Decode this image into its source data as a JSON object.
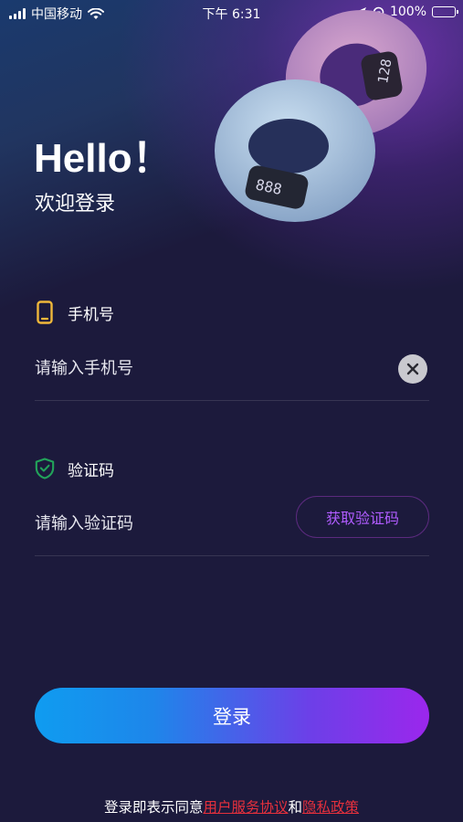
{
  "status_bar": {
    "carrier": "中国移动",
    "time": "下午 6:31",
    "battery": "100%",
    "icons": [
      "signal-icon",
      "wifi-icon",
      "location-icon",
      "rotation-lock-icon",
      "battery-charging-icon"
    ]
  },
  "hero": {
    "title": "Hello！",
    "subtitle": "欢迎登录",
    "display_small": "128",
    "display_large": "888"
  },
  "phone": {
    "label": "手机号",
    "placeholder": "请输入手机号",
    "icon": "phone-icon",
    "icon_color": "#f0b83a"
  },
  "code": {
    "label": "验证码",
    "placeholder": "请输入验证码",
    "icon": "shield-check-icon",
    "icon_color": "#22a35a",
    "get_code_label": "获取验证码"
  },
  "login": {
    "label": "登录"
  },
  "agreement": {
    "prefix": "登录即表示同意",
    "terms": "用户服务协议",
    "and": "和",
    "privacy": "隐私政策",
    "link_color": "#e5303c"
  },
  "colors": {
    "background": "#1c1a3c",
    "accent_purple": "#b05cff",
    "gradient_start": "#0f9cf0",
    "gradient_end": "#9b27ec"
  }
}
